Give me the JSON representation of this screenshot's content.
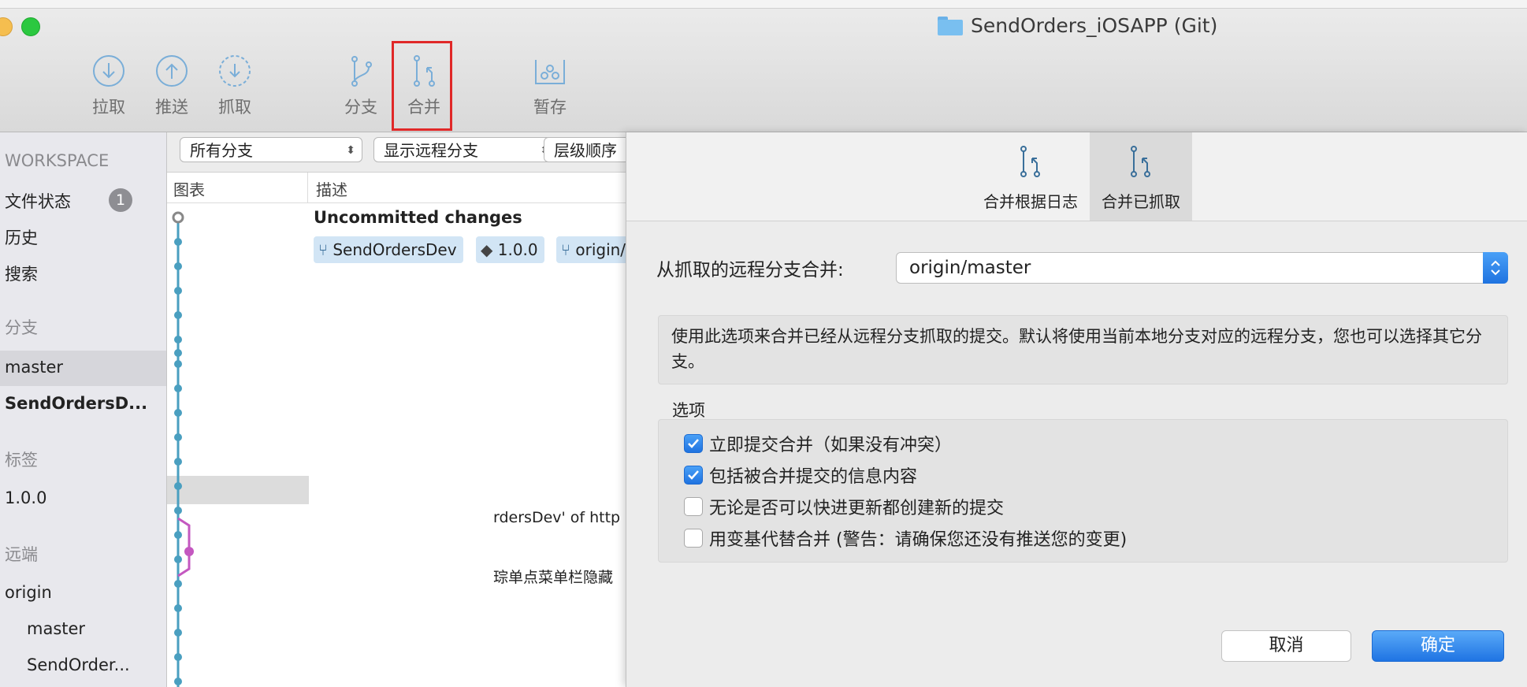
{
  "window": {
    "title": "SendOrders_iOSAPP (Git)"
  },
  "toolbar": {
    "pull": "拉取",
    "push": "推送",
    "fetch": "抓取",
    "branch": "分支",
    "merge": "合并",
    "stash": "暂存"
  },
  "sidebar": {
    "workspace_header": "WORKSPACE",
    "file_status": "文件状态",
    "file_status_badge": "1",
    "history": "历史",
    "search": "搜索",
    "branches_header": "分支",
    "branches": [
      "master",
      "SendOrdersD..."
    ],
    "tags_header": "标签",
    "tags": [
      "1.0.0"
    ],
    "remotes_header": "远端",
    "remote_name": "origin",
    "remote_branches": [
      "master",
      "SendOrder..."
    ]
  },
  "main": {
    "filters": [
      "所有分支",
      "显示远程分支",
      "层级顺序"
    ],
    "columns": {
      "graph": "图表",
      "description": "描述"
    },
    "uncommitted": "Uncommitted changes",
    "tags": [
      "SendOrdersDev",
      "1.0.0",
      "origin/"
    ],
    "messages": [
      "rdersDev' of http",
      "琮单点菜单栏隐藏"
    ]
  },
  "dialog": {
    "tabs": [
      "合并根据日志",
      "合并已抓取"
    ],
    "active_tab": "合并已抓取",
    "remote_label": "从抓取的远程分支合并:",
    "remote_value": "origin/master",
    "description": "使用此选项来合并已经从远程分支抓取的提交。默认将使用当前本地分支对应的远程分支，您也可以选择其它分支。",
    "options_title": "选项",
    "options": [
      {
        "label": "立即提交合并（如果没有冲突）",
        "checked": true
      },
      {
        "label": "包括被合并提交的信息内容",
        "checked": true
      },
      {
        "label": "无论是否可以快进更新都创建新的提交",
        "checked": false
      },
      {
        "label": "用变基代替合并 (警告：请确保您还没有推送您的变更)",
        "checked": false
      }
    ],
    "cancel": "取消",
    "ok": "确定"
  },
  "colors": {
    "accent": "#1f74e3",
    "graph_main": "#4a9fc0",
    "graph_branch": "#c458c0",
    "highlight_box": "#e02828"
  }
}
